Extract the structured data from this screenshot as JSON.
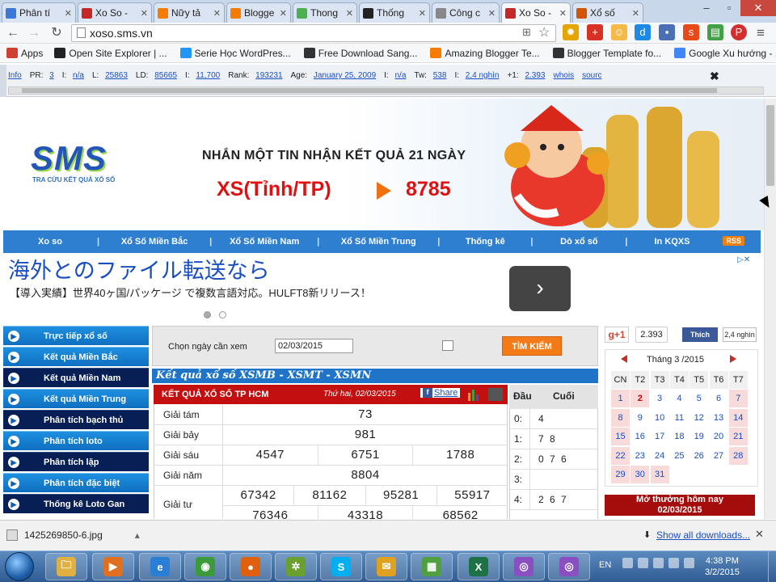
{
  "browser": {
    "tabs": [
      {
        "label": "Phân tí",
        "color": "#3b78d8"
      },
      {
        "label": "Xo So -",
        "color": "#c62828"
      },
      {
        "label": "Nữy tả",
        "color": "#f57c00"
      },
      {
        "label": "Blogge",
        "color": "#f57c00"
      },
      {
        "label": "Thong",
        "color": "#4caf50"
      },
      {
        "label": "Thống",
        "color": "#222222"
      },
      {
        "label": "Công c",
        "color": "#888888"
      },
      {
        "label": "Xo So -",
        "color": "#c62828"
      },
      {
        "label": "Xổ số",
        "color": "#d35400"
      }
    ],
    "url": "xoso.sms.vn",
    "bookmarks": [
      {
        "label": "Apps",
        "color": "#d04030"
      },
      {
        "label": "Open Site Explorer | ...",
        "color": "#222222"
      },
      {
        "label": "Serie Học WordPres...",
        "color": "#2196f3"
      },
      {
        "label": "Free Download Sang...",
        "color": "#333333"
      },
      {
        "label": "Amazing Blogger Te...",
        "color": "#f57c00"
      },
      {
        "label": "Blogger Template fo...",
        "color": "#333333"
      },
      {
        "label": "Google Xu hướng - ...",
        "color": "#4285f4"
      }
    ]
  },
  "seobar": {
    "info": "Info",
    "pr_label": "PR:",
    "pr": "3",
    "i1_label": "I:",
    "i1": "n/a",
    "l_label": "L:",
    "l": "25863",
    "ld_label": "LD:",
    "ld": "85665",
    "i2_label": "I:",
    "i2": "11,700",
    "rank_label": "Rank:",
    "rank": "193231",
    "age_label": "Age:",
    "age": "January 25, 2009",
    "i3_label": "I:",
    "i3": "n/a",
    "tw_label": "Tw:",
    "tw": "538",
    "i4_label": "I:",
    "i4": "2,4 nghìn",
    "gplus_label": "+1:",
    "gplus": "2.393",
    "whois": "whois",
    "source": "sourc"
  },
  "site": {
    "logo": "SMS",
    "logo_sub": "TRA CỨU KẾT QUẢ XỔ SỐ",
    "promo_line": "NHẮN MỘT TIN NHẬN KẾT QUẢ 21 NGÀY",
    "promo_cmd": "XS(Tỉnh/TP)",
    "promo_code": "8785",
    "menu": [
      "Xo so",
      "Xổ Số Miền Bắc",
      "Xổ Số Miền Nam",
      "Xổ Số Miền Trung",
      "Thống kê",
      "Dò xổ số",
      "In KQXS"
    ],
    "rss": "RSS",
    "ad": {
      "headline": "海外とのファイル転送なら",
      "text": "【導入実績】世界40ヶ国/パッケージ で複数言語対応。HULFT8新リリース！",
      "button": "›"
    },
    "sidebar": [
      "Trực tiếp xổ số",
      "Kết quả Miền Bắc",
      "Kết quả Miền Nam",
      "Kết quả Miền Trung",
      "Phân tích bạch thủ",
      "Phân tích loto",
      "Phân tích lặp",
      "Phân tích đặc biệt",
      "Thống kê Loto Gan"
    ],
    "search": {
      "label": "Chọn ngày cần xem",
      "date": "02/03/2015",
      "button": "TÌM KIẾM"
    },
    "section_title": "Kết quả xổ số XSMB - XSMT - XSMN",
    "results": {
      "title": "KẾT QUẢ XỔ SỐ TP HCM",
      "date": "Thứ hai, 02/03/2015",
      "share": "Share",
      "rows": [
        {
          "label": "Giải tám",
          "values": [
            "73"
          ]
        },
        {
          "label": "Giải bảy",
          "values": [
            "981"
          ]
        },
        {
          "label": "Giải sáu",
          "values": [
            "4547",
            "6751",
            "1788"
          ]
        },
        {
          "label": "Giải năm",
          "values": [
            "8804"
          ]
        },
        {
          "label": "Giải tư",
          "values": [
            "67342",
            "81162",
            "95281",
            "55917"
          ],
          "values2": [
            "76346",
            "43318",
            "68562"
          ]
        }
      ]
    },
    "dau_cuoi": {
      "head_dau": "Đầu",
      "head_cuoi": "Cuối",
      "rows": [
        {
          "d": "0:",
          "c": "4"
        },
        {
          "d": "1:",
          "c": "7 8"
        },
        {
          "d": "2:",
          "c": "0 7 6"
        },
        {
          "d": "3:",
          "c": ""
        },
        {
          "d": "4:",
          "c": "2 6 7"
        }
      ]
    },
    "social": {
      "gplus": "g+1",
      "gplus_count": "2.393",
      "fb": "Thích",
      "fb_count": "2,4 nghìn"
    },
    "calendar": {
      "title": "Tháng 3 /2015",
      "weekdays": [
        "CN",
        "T2",
        "T3",
        "T4",
        "T5",
        "T6",
        "T7"
      ],
      "weeks": [
        [
          "1",
          "2",
          "3",
          "4",
          "5",
          "6",
          "7"
        ],
        [
          "8",
          "9",
          "10",
          "11",
          "12",
          "13",
          "14"
        ],
        [
          "15",
          "16",
          "17",
          "18",
          "19",
          "20",
          "21"
        ],
        [
          "22",
          "23",
          "24",
          "25",
          "26",
          "27",
          "28"
        ],
        [
          "29",
          "30",
          "31",
          "",
          "",
          "",
          ""
        ]
      ],
      "today": "2"
    },
    "open_today_line1": "Mở thưởng hôm nay",
    "open_today_line2": "02/03/2015"
  },
  "downloads": {
    "file": "1425269850-6.jpg",
    "show_all": "Show all downloads..."
  },
  "taskbar": {
    "apps": [
      {
        "name": "explorer",
        "glyph": "🗀",
        "color": "#e0b040"
      },
      {
        "name": "media",
        "glyph": "▶",
        "color": "#e07020"
      },
      {
        "name": "ie",
        "glyph": "e",
        "color": "#2a7fd4"
      },
      {
        "name": "chrome",
        "glyph": "◉",
        "color": "#3c9a3c"
      },
      {
        "name": "firefox",
        "glyph": "●",
        "color": "#e06010"
      },
      {
        "name": "app",
        "glyph": "✲",
        "color": "#6aa030"
      },
      {
        "name": "skype",
        "glyph": "S",
        "color": "#00aff0"
      },
      {
        "name": "mail",
        "glyph": "✉",
        "color": "#e0a020"
      },
      {
        "name": "chart",
        "glyph": "▦",
        "color": "#50a040"
      },
      {
        "name": "excel",
        "glyph": "X",
        "color": "#1e7145"
      },
      {
        "name": "tool1",
        "glyph": "◎",
        "color": "#8a4fc0"
      },
      {
        "name": "tool2",
        "glyph": "◎",
        "color": "#8a4fc0"
      }
    ],
    "lang": "EN",
    "time": "4:38 PM",
    "date": "3/2/2015"
  }
}
